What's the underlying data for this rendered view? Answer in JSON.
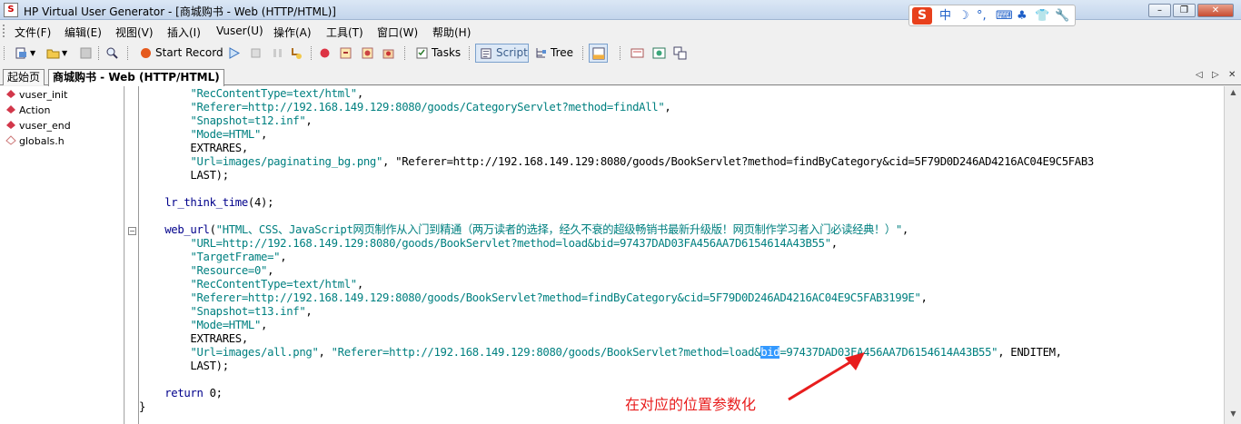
{
  "window": {
    "title": "HP Virtual User Generator - [商城购书 - Web (HTTP/HTML)]",
    "controls": [
      "–",
      "❐",
      "✕"
    ]
  },
  "ime": {
    "logo": "S",
    "items": [
      "中",
      "☽",
      "°,",
      "⌨",
      "♣",
      "👕",
      "🔧"
    ]
  },
  "menu": [
    "文件(F)",
    "编辑(E)",
    "视图(V)",
    "插入(I)",
    "Vuser(U)",
    "操作(A)",
    "工具(T)",
    "窗口(W)",
    "帮助(H)"
  ],
  "toolbar": {
    "start_record": "Start Record",
    "tasks": "Tasks",
    "script": "Script",
    "tree": "Tree"
  },
  "tabs": [
    {
      "label": "起始页",
      "active": false
    },
    {
      "label": "商城购书 - Web (HTTP/HTML)",
      "active": true
    }
  ],
  "tab_nav": [
    "◁",
    "▷",
    "✕"
  ],
  "sidebar": {
    "items": [
      {
        "label": "vuser_init",
        "icon": "action-icon"
      },
      {
        "label": "Action",
        "icon": "action-icon"
      },
      {
        "label": "vuser_end",
        "icon": "action-icon"
      },
      {
        "label": "globals.h",
        "icon": "header-icon"
      }
    ]
  },
  "code": [
    "        \"RecContentType=text/html\",",
    "        \"Referer=http://192.168.149.129:8080/goods/CategoryServlet?method=findAll\",",
    "        \"Snapshot=t12.inf\",",
    "        \"Mode=HTML\",",
    "        EXTRARES,",
    "        \"Url=images/paginating_bg.png\", \"Referer=http://192.168.149.129:8080/goods/BookServlet?method=findByCategory&cid=5F79D0D246AD4216AC04E9C5FAB3",
    "        LAST);",
    "",
    "    lr_think_time(4);",
    "",
    "    web_url(\"HTML、CSS、JavaScript网页制作从入门到精通（两万读者的选择，经久不衰的超级畅销书最新升级版！网页制作学习者入门必读经典！）\",",
    "        \"URL=http://192.168.149.129:8080/goods/BookServlet?method=load&bid=97437DAD03FA456AA7D6154614A43B55\",",
    "        \"TargetFrame=\",",
    "        \"Resource=0\",",
    "        \"RecContentType=text/html\",",
    "        \"Referer=http://192.168.149.129:8080/goods/BookServlet?method=findByCategory&cid=5F79D0D246AD4216AC04E9C5FAB3199E\",",
    "        \"Snapshot=t13.inf\",",
    "        \"Mode=HTML\",",
    "        EXTRARES,",
    "        \"Url=images/all.png\", \"Referer=http://192.168.149.129:8080/goods/BookServlet?method=load&bid=97437DAD03FA456AA7D6154614A43B55\", ENDITEM,",
    "        LAST);",
    "",
    "    return 0;",
    "}"
  ],
  "highlight": "bid",
  "annotation": "在对应的位置参数化",
  "colors": {
    "annotation": "#e81d1d",
    "selection": "#3399ff",
    "string": "#008080",
    "keyword": "#00008b"
  }
}
